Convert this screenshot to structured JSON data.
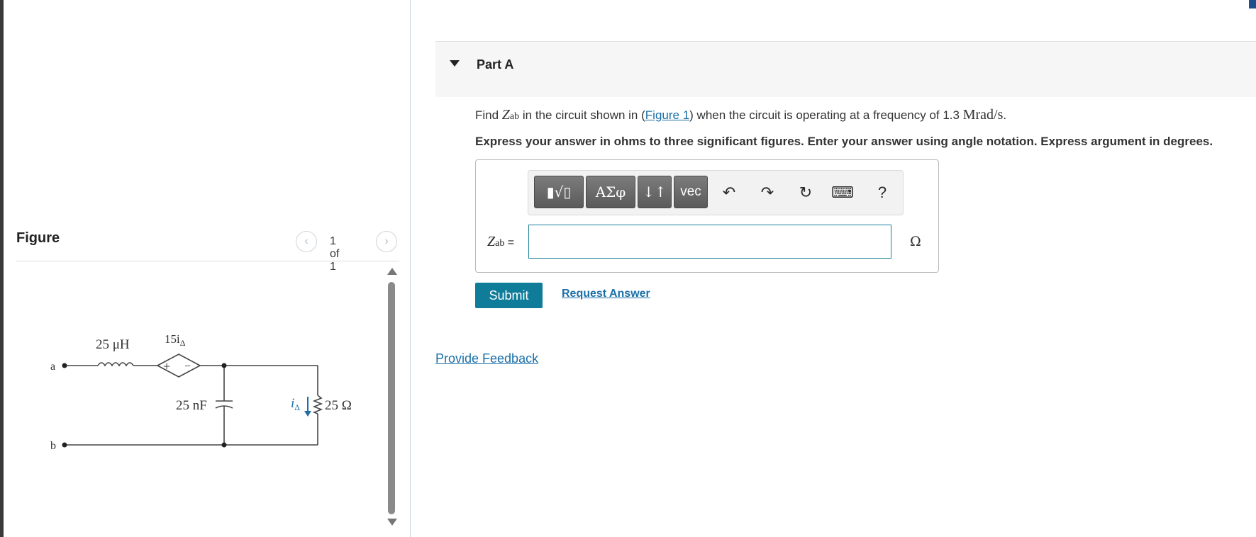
{
  "figure": {
    "title": "Figure",
    "pager_text": "1 of 1",
    "prev_glyph": "‹",
    "next_glyph": "›",
    "circuit_labels": {
      "inductor": "25 μH",
      "dependent_source": "15i",
      "dependent_source_sub": "Δ",
      "capacitor": "25 nF",
      "current": "i",
      "current_sub": "Δ",
      "resistor": "25 Ω",
      "node_a": "a",
      "node_b": "b",
      "plus": "+",
      "minus": "−"
    }
  },
  "part": {
    "title": "Part A",
    "question_prefix": "Find ",
    "question_var": "Z",
    "question_var_sub": "ab",
    "question_mid": " in the circuit shown in (",
    "figure_link": "Figure 1",
    "question_after_link": ") when the circuit is operating at a frequency of 1.3 ",
    "question_unit": "Mrad/s",
    "question_end": ".",
    "instruction": "Express your answer in ohms to three significant figures. Enter your answer using angle notation. Express argument in degrees."
  },
  "toolbar": {
    "templates_glyph": "▮√▯",
    "greek_label": "ΑΣφ",
    "arrows_glyph": "↓↑",
    "vec_label": "vec",
    "undo_glyph": "↶",
    "redo_glyph": "↷",
    "reset_glyph": "↻",
    "keyboard_glyph": "⌨",
    "help_label": "?"
  },
  "answer": {
    "label_var": "Z",
    "label_sub": "ab",
    "label_eq": " =",
    "value": "",
    "unit": "Ω"
  },
  "actions": {
    "submit_label": "Submit",
    "request_label": "Request Answer",
    "feedback_label": "Provide Feedback"
  }
}
